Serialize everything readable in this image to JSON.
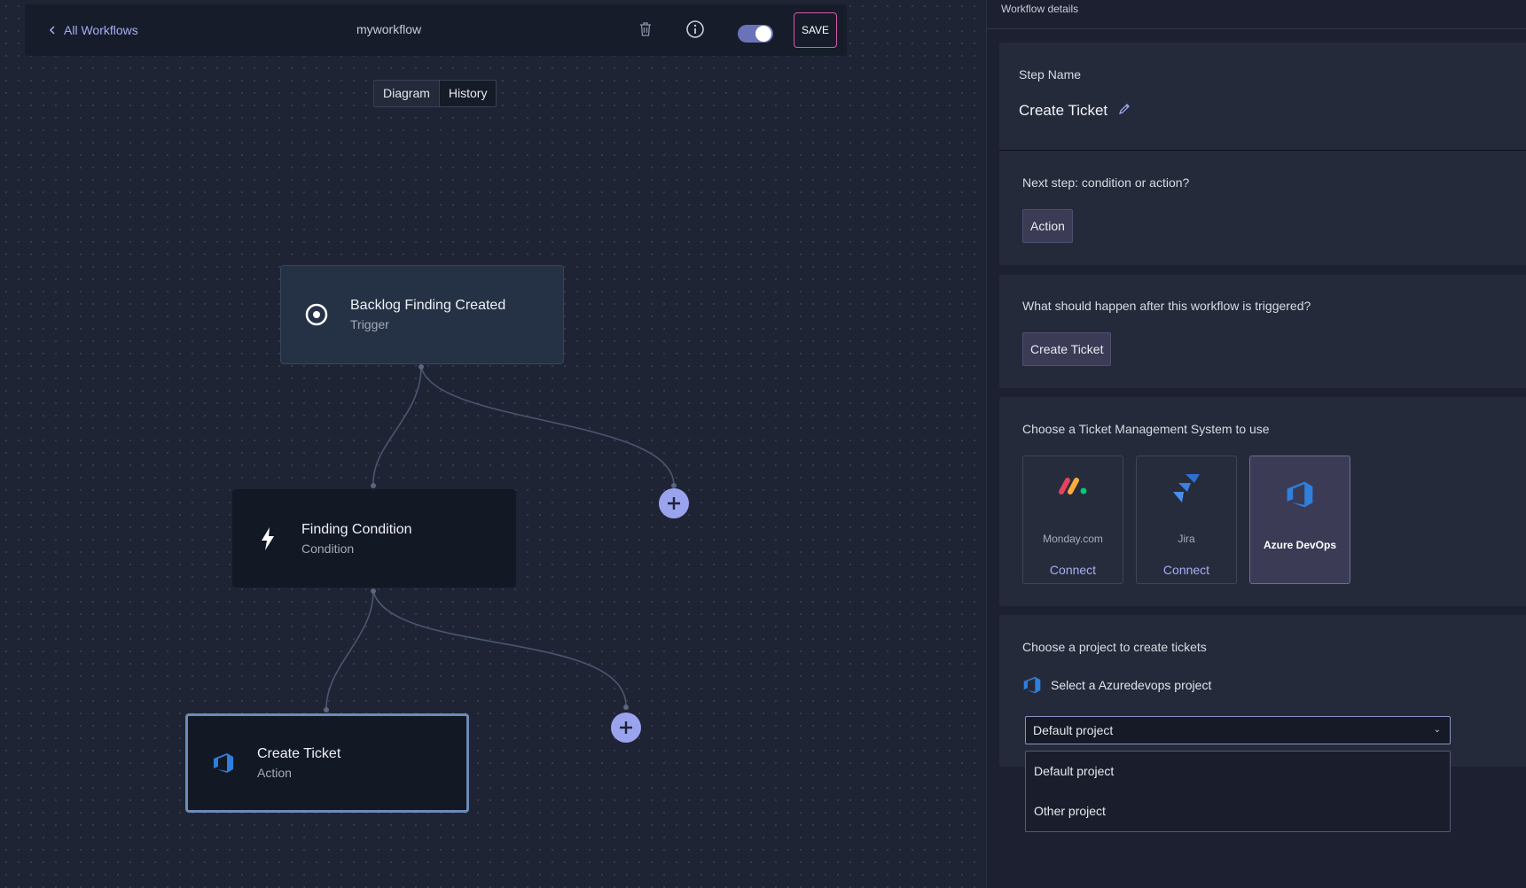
{
  "header": {
    "back_label": "All Workflows",
    "workflow_name": "myworkflow",
    "save_label": "SAVE"
  },
  "view_tabs": [
    {
      "label": "Diagram",
      "active": true
    },
    {
      "label": "History",
      "active": false
    }
  ],
  "nodes": {
    "trigger": {
      "title": "Backlog Finding Created",
      "subtitle": "Trigger",
      "icon": "target-icon"
    },
    "condition": {
      "title": "Finding Condition",
      "subtitle": "Condition",
      "icon": "lightning-icon"
    },
    "action": {
      "title": "Create Ticket",
      "subtitle": "Action",
      "icon": "azure-devops-icon"
    }
  },
  "panel": {
    "title": "Workflow details",
    "step_name_label": "Step Name",
    "step_name_value": "Create Ticket",
    "next_step_question": "Next step: condition or action?",
    "next_step_value": "Action",
    "after_trigger_question": "What should happen after this workflow is triggered?",
    "after_trigger_value": "Create Ticket",
    "tms_question": "Choose a Ticket Management System to use",
    "tms_options": [
      {
        "name": "Monday.com",
        "connect_label": "Connect",
        "selected": false
      },
      {
        "name": "Jira",
        "connect_label": "Connect",
        "selected": false
      },
      {
        "name": "Azure DevOps",
        "selected": true
      }
    ],
    "project_question": "Choose a project to create tickets",
    "project_sub_label": "Select a Azuredevops project",
    "project_selected": "Default project",
    "project_options": [
      "Default project",
      "Other project"
    ]
  },
  "colors": {
    "accent": "#a5aef5",
    "save_border": "#d65aa8",
    "azure_blue": "#2f7fdc",
    "add_button": "#9aa4ee"
  }
}
